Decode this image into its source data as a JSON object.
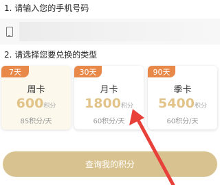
{
  "step1": {
    "label": "1. 请输入您的手机号码"
  },
  "phone": {
    "value": "",
    "placeholder": ""
  },
  "step2": {
    "label": "2. 请选择您要兑换的类型"
  },
  "cards": [
    {
      "tag": "7天",
      "name": "周卡",
      "points": "600",
      "unit": "积分",
      "rate": "85积分/天",
      "selected": true
    },
    {
      "tag": "30天",
      "name": "月卡",
      "points": "1800",
      "unit": "积分",
      "rate": "60积分/天",
      "selected": false
    },
    {
      "tag": "90天",
      "name": "季卡",
      "points": "5400",
      "unit": "积分",
      "rate": "60积分/天",
      "selected": false
    }
  ],
  "query_button": {
    "label": "查询我的积分"
  },
  "colors": {
    "tag_bg": "#e8894a",
    "points": "#e2c48a",
    "button_bg": "#d8c28f",
    "annotation_arrow": "#e8413a"
  },
  "icons": {
    "phone": "phone-icon",
    "annotation": "red-arrow-icon"
  }
}
